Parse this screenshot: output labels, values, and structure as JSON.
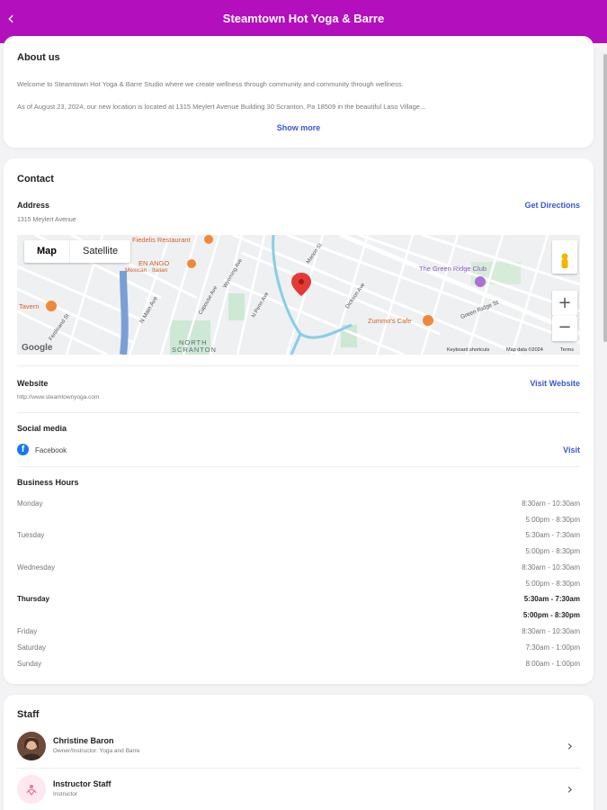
{
  "header": {
    "title": "Steamtown Hot Yoga & Barre",
    "back_icon": "chevron-left-icon"
  },
  "about": {
    "heading": "About us",
    "paragraph1": "Welcome to Steamtown Hot Yoga & Barre Studio where we create wellness through community and community through wellness.",
    "paragraph2": "As of August 23, 2024, our new location is located at 1315 Meylert Avenue Building 30 Scranton, Pa 18509 in the beautiful Laso Village...",
    "show_more": "Show more"
  },
  "contact": {
    "heading": "Contact",
    "address_label": "Address",
    "address_value": "1315 Meylert Avenue",
    "directions_link": "Get Directions",
    "map": {
      "toggle_map": "Map",
      "toggle_satellite": "Satellite",
      "zoom_in": "+",
      "zoom_out": "−",
      "labels": {
        "restaurant": "Fiedelis Restaurant",
        "mexican_name": "EN ANGO",
        "mexican_type": "Mexican · Italian",
        "club": "The Green Ridge Club",
        "cafe": "Zummo's Cafe",
        "tavern": "Tavern",
        "north": "NORTH",
        "scranton": "SCRANTON",
        "green_ridge": "Green Ridge St",
        "main_ave": "N Main Ave",
        "marion": "Marion St",
        "dickson": "Dickson Ave",
        "ferdinand": "Ferdinand St",
        "capouse": "Capouse Ave",
        "wyoming": "Wyoming Ave",
        "penn": "N Penn Ave"
      },
      "footer_google": "Google",
      "footer_shortcuts": "Keyboard shortcuts",
      "footer_mapdata": "Map data ©2024",
      "footer_terms": "Terms"
    },
    "website_label": "Website",
    "website_value": "http://www.steamtownyoga.com",
    "website_link": "Visit Website",
    "social_label": "Social media",
    "social_facebook": "Facebook",
    "social_link": "Visit",
    "hours_label": "Business Hours",
    "hours": [
      {
        "day": "Monday",
        "times": [
          "8:30am - 10:30am",
          "5:00pm - 8:30pm"
        ]
      },
      {
        "day": "Tuesday",
        "times": [
          "5:30am - 7:30am",
          "5:00pm - 8:30pm"
        ]
      },
      {
        "day": "Wednesday",
        "times": [
          "8:30am - 10:30am",
          "5:00pm - 8:30pm"
        ]
      },
      {
        "day": "Thursday",
        "times": [
          "5:30am - 7:30am",
          "5:00pm - 8:30pm"
        ],
        "highlight": true
      },
      {
        "day": "Friday",
        "times": [
          "8:30am - 10:30am"
        ]
      },
      {
        "day": "Saturday",
        "times": [
          "7:30am - 1:00pm"
        ]
      },
      {
        "day": "Sunday",
        "times": [
          "8:00am - 1:00pm"
        ]
      }
    ]
  },
  "staff": {
    "heading": "Staff",
    "members": [
      {
        "name": "Christine Baron",
        "role": "Owner/Instructor: Yoga and Barre"
      },
      {
        "name": "Instructor Staff",
        "role": "Instructor"
      }
    ]
  },
  "colors": {
    "brand": "#b30fbd",
    "link": "#3a57d8",
    "pin": "#e53935"
  }
}
